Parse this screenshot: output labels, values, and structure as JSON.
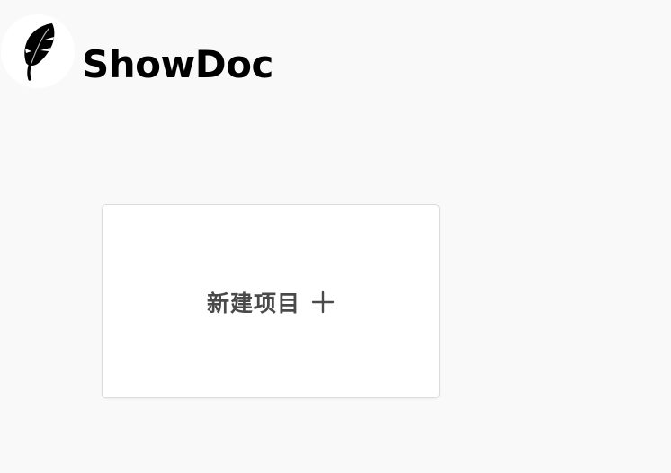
{
  "header": {
    "brand": "ShowDoc",
    "logo_icon": "feather-icon"
  },
  "card": {
    "label": "新建项目",
    "icon": "plus-icon"
  },
  "colors": {
    "background": "#f9f9f9",
    "card_background": "#ffffff",
    "card_border": "#dcdcdc",
    "label_text": "#4a4a4a",
    "brand_text": "#000000"
  }
}
